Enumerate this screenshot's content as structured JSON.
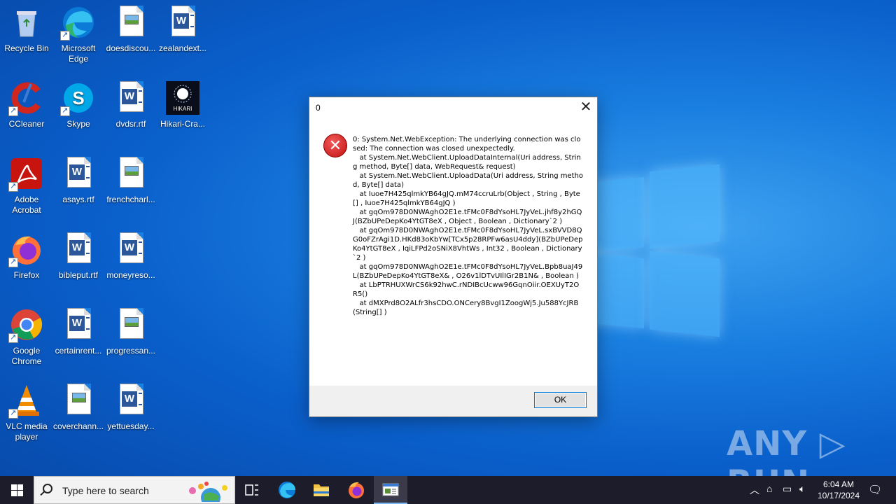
{
  "desktop": {
    "icons": [
      {
        "label": "Recycle Bin"
      },
      {
        "label": "Microsoft Edge"
      },
      {
        "label": "doesdiscou..."
      },
      {
        "label": "zealandext..."
      },
      {
        "label": "CCleaner"
      },
      {
        "label": "Skype"
      },
      {
        "label": "dvdsr.rtf"
      },
      {
        "label": "Hikari-Cra..."
      },
      {
        "label": "Adobe Acrobat"
      },
      {
        "label": "asays.rtf"
      },
      {
        "label": "frenchcharl..."
      },
      {
        "label": "Firefox"
      },
      {
        "label": "bibleput.rtf"
      },
      {
        "label": "moneyreso..."
      },
      {
        "label": "Google Chrome"
      },
      {
        "label": "certainrent..."
      },
      {
        "label": "progressan..."
      },
      {
        "label": "VLC media player"
      },
      {
        "label": "coverchann..."
      },
      {
        "label": "yettuesday..."
      }
    ],
    "hikari_logo_text": "HIKARI"
  },
  "dialog": {
    "title": "0",
    "close_glyph": "✕",
    "error_glyph": "✕",
    "message": "0: System.Net.WebException: The underlying connection was closed: The connection was closed unexpectedly.\n   at System.Net.WebClient.UploadDataInternal(Uri address, String method, Byte[] data, WebRequest& request)\n   at System.Net.WebClient.UploadData(Uri address, String method, Byte[] data)\n   at Iuoe7H425qlmkYB64gJQ.mM74ccruLrb(Object , String , Byte[] , Iuoe7H425qlmkYB64gJQ )\n   at gqOm978D0NWAghO2E1e.tFMc0F8dYsoHL7JyVeL.jhf8y2hGQJ(BZbUPeDepKo4YtGT8eX , Object , Boolean , Dictionary`2 )\n   at gqOm978D0NWAghO2E1e.tFMc0F8dYsoHL7JyVeL.sxBVVD8QG0oFZrAgi1D.HKd83oKbYw[TCx5p28RPFw6asU4ddy](BZbUPeDepKo4YtGT8eX , IqiLFPd2oSNiX8VhtWs , Int32 , Boolean , Dictionary`2 )\n   at gqOm978D0NWAghO2E1e.tFMc0F8dYsoHL7JyVeL.Bpb8uaJ49L(BZbUPeDepKo4YtGT8eX& , O26v1lDTvUIlIGr2B1N& , Boolean )\n   at LbPTRHUXWrCS6k92hwC.rNDIBcUcww96GqnOiir.OEXUyT2OR5()\n   at dMXPrd8O2ALfr3hsCDO.ONCery8BvgI1ZoogWj5.Ju588YcJRB(String[] )",
    "ok_label": "OK"
  },
  "watermark": "ANY ▷ RUN",
  "taskbar": {
    "search_placeholder": "Type here to search",
    "clock_time": "6:04 AM",
    "clock_date": "10/17/2024"
  },
  "colors": {
    "accent": "#0078d7",
    "error_red": "#c01010",
    "taskbar": "#1c1c2a"
  }
}
